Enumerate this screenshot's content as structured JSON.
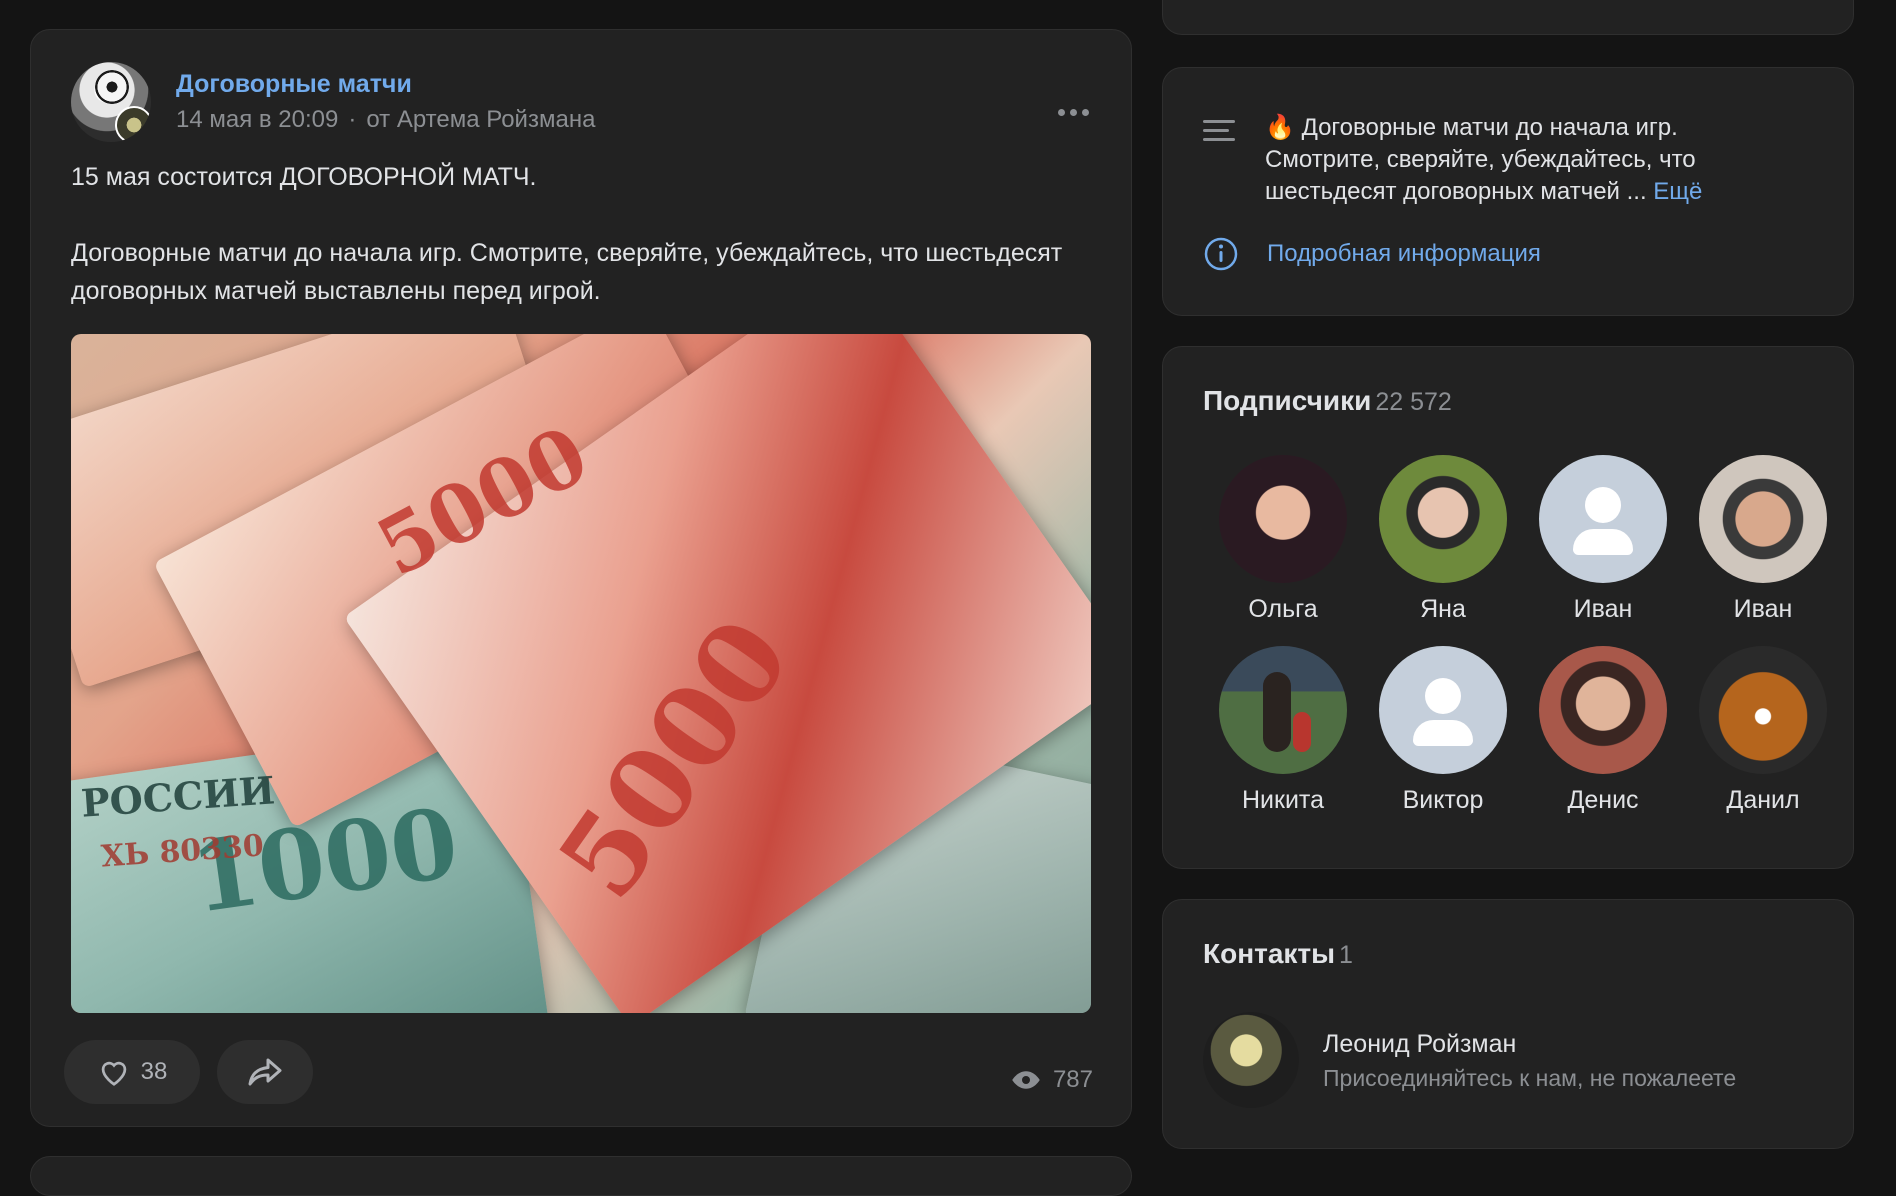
{
  "post": {
    "author": "Договорные матчи",
    "date": "14 мая в 20:09",
    "from": "от Артема Ройзмана",
    "text": "15 мая состоится ДОГОВОРНОЙ МАТЧ.\n\nДоговорные матчи до начала игр. Смотрите, сверяйте, убеждайтесь, что шестьдесят договорных матчей выставлены перед игрой.",
    "image_alt": "Russian ruble banknotes",
    "image_labels": [
      "5000",
      "1000",
      "5000",
      "РОССИИ",
      "ХЬ 80330"
    ],
    "likes": "38",
    "views": "787"
  },
  "info": {
    "description": "Договорные матчи до начала игр. Смотрите, сверяйте, убеждайтесь, что шестьдесят договорных матчей ...",
    "more": "Ещё",
    "details_link": "Подробная информация",
    "fire_icon": "🔥"
  },
  "subscribers": {
    "title": "Подписчики",
    "count": "22 572",
    "items": [
      {
        "name": "Ольга",
        "color": "#5a3a4a"
      },
      {
        "name": "Яна",
        "color": "#6e8a3c"
      },
      {
        "name": "Иван",
        "placeholder": true
      },
      {
        "name": "Иван",
        "color": "#9a8a7a"
      },
      {
        "name": "Никита",
        "color": "#4f6e43"
      },
      {
        "name": "Виктор",
        "placeholder": true
      },
      {
        "name": "Денис",
        "color": "#a8584a"
      },
      {
        "name": "Данил",
        "color": "#b5651d"
      }
    ]
  },
  "contacts": {
    "title": "Контакты",
    "count": "1",
    "name": "Леонид Ройзман",
    "description": "Присоединяйтесь к нам, не пожалеете"
  },
  "colors": {
    "accent": "#71aaeb",
    "card_bg": "#222222",
    "page_bg": "#141414",
    "muted": "#8c8f93"
  }
}
